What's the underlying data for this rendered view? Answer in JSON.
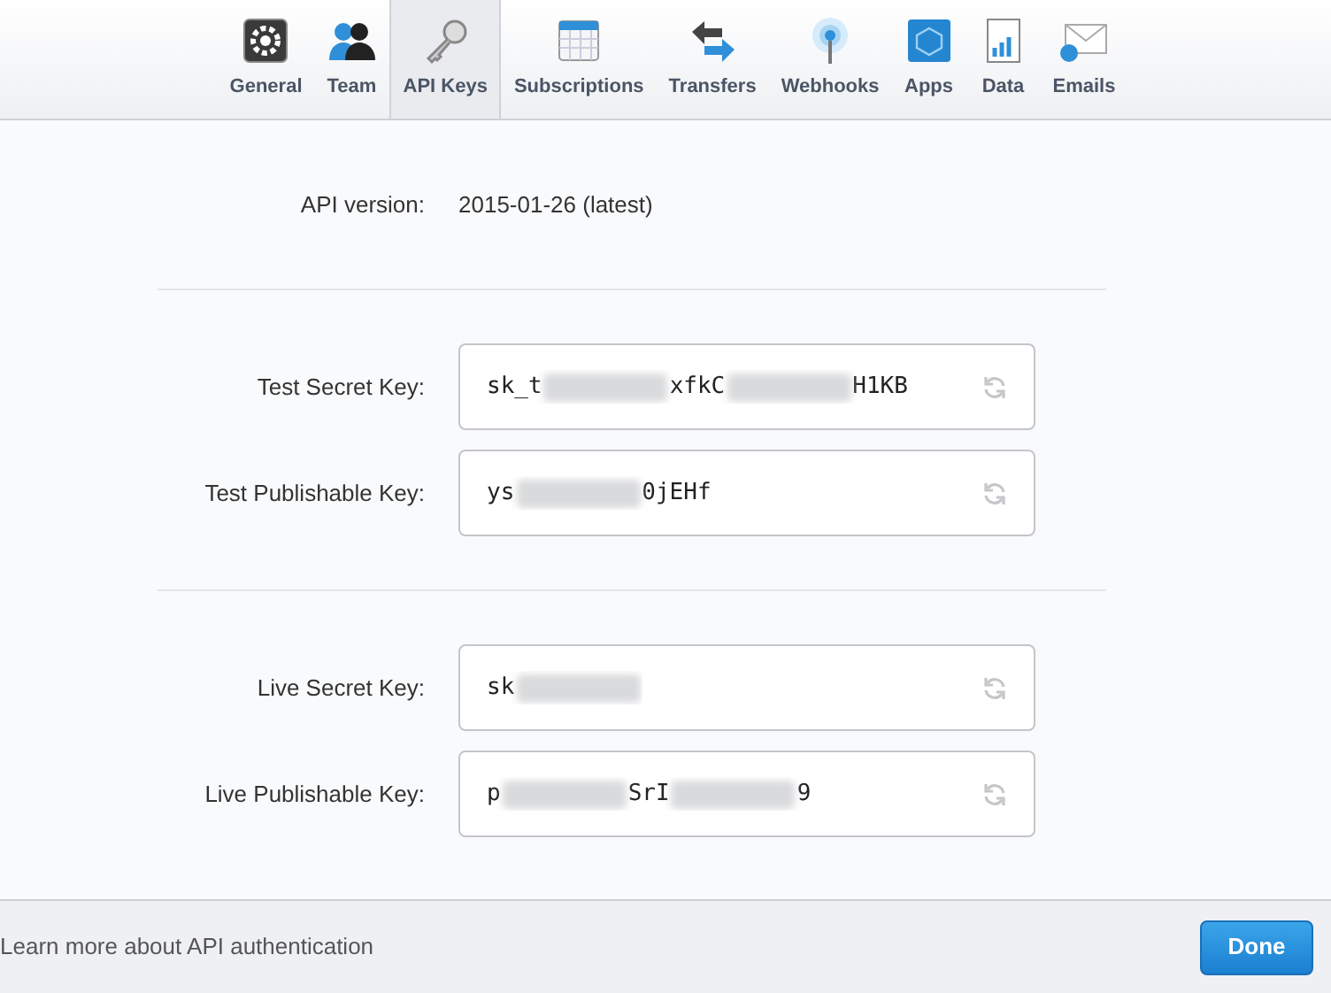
{
  "tabs": [
    {
      "label": "General",
      "kind": "gear",
      "selected": false
    },
    {
      "label": "Team",
      "kind": "people",
      "selected": false
    },
    {
      "label": "API Keys",
      "kind": "key",
      "selected": true
    },
    {
      "label": "Subscriptions",
      "kind": "calendar",
      "selected": false
    },
    {
      "label": "Transfers",
      "kind": "arrows",
      "selected": false
    },
    {
      "label": "Webhooks",
      "kind": "signal",
      "selected": false
    },
    {
      "label": "Apps",
      "kind": "cube",
      "selected": false
    },
    {
      "label": "Data",
      "kind": "chart",
      "selected": false
    },
    {
      "label": "Emails",
      "kind": "envelope",
      "selected": false
    }
  ],
  "api_version": {
    "label": "API version:",
    "value": "2015-01-26 (latest)"
  },
  "key_groups": [
    {
      "keys": [
        {
          "label": "Test Secret Key:",
          "visible_parts": [
            "sk_t",
            "xfkC",
            "H1KB"
          ]
        },
        {
          "label": "Test Publishable Key:",
          "visible_parts": [
            "ys",
            "0jEHf"
          ]
        }
      ]
    },
    {
      "keys": [
        {
          "label": "Live Secret Key:",
          "visible_parts": [
            "sk"
          ],
          "ends_blurred": true
        },
        {
          "label": "Live Publishable Key:",
          "visible_parts": [
            "p",
            "SrI",
            "9"
          ]
        }
      ]
    }
  ],
  "footer": {
    "link": "Learn more about API authentication",
    "button": "Done"
  }
}
